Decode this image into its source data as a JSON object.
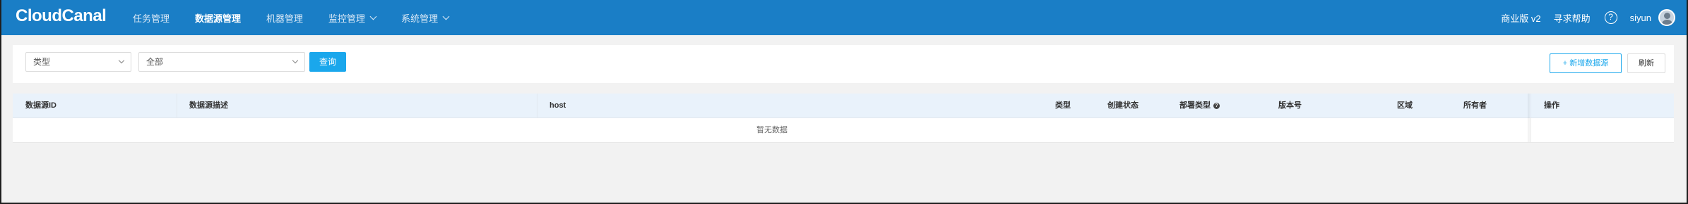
{
  "header": {
    "logo": "CloudCanal",
    "nav": [
      {
        "label": "任务管理"
      },
      {
        "label": "数据源管理",
        "active": true
      },
      {
        "label": "机器管理"
      },
      {
        "label": "监控管理",
        "dropdown": true
      },
      {
        "label": "系统管理",
        "dropdown": true
      }
    ],
    "edition": "商业版 v2",
    "help": "寻求帮助",
    "help_icon_glyph": "?",
    "username": "siyun",
    "brand_color": "#1a7ec6"
  },
  "filters": {
    "type_select": "类型",
    "scope_select": "全部",
    "query_button": "查询",
    "add_button": "+ 新增数据源",
    "refresh_button": "刷新"
  },
  "table": {
    "columns": [
      "数据源ID",
      "数据源描述",
      "host",
      "类型",
      "创建状态",
      "部署类型",
      "版本号",
      "区域",
      "所有者",
      "操作"
    ],
    "empty_text": "暂无数据",
    "header_bg": "#e9f2fb"
  }
}
